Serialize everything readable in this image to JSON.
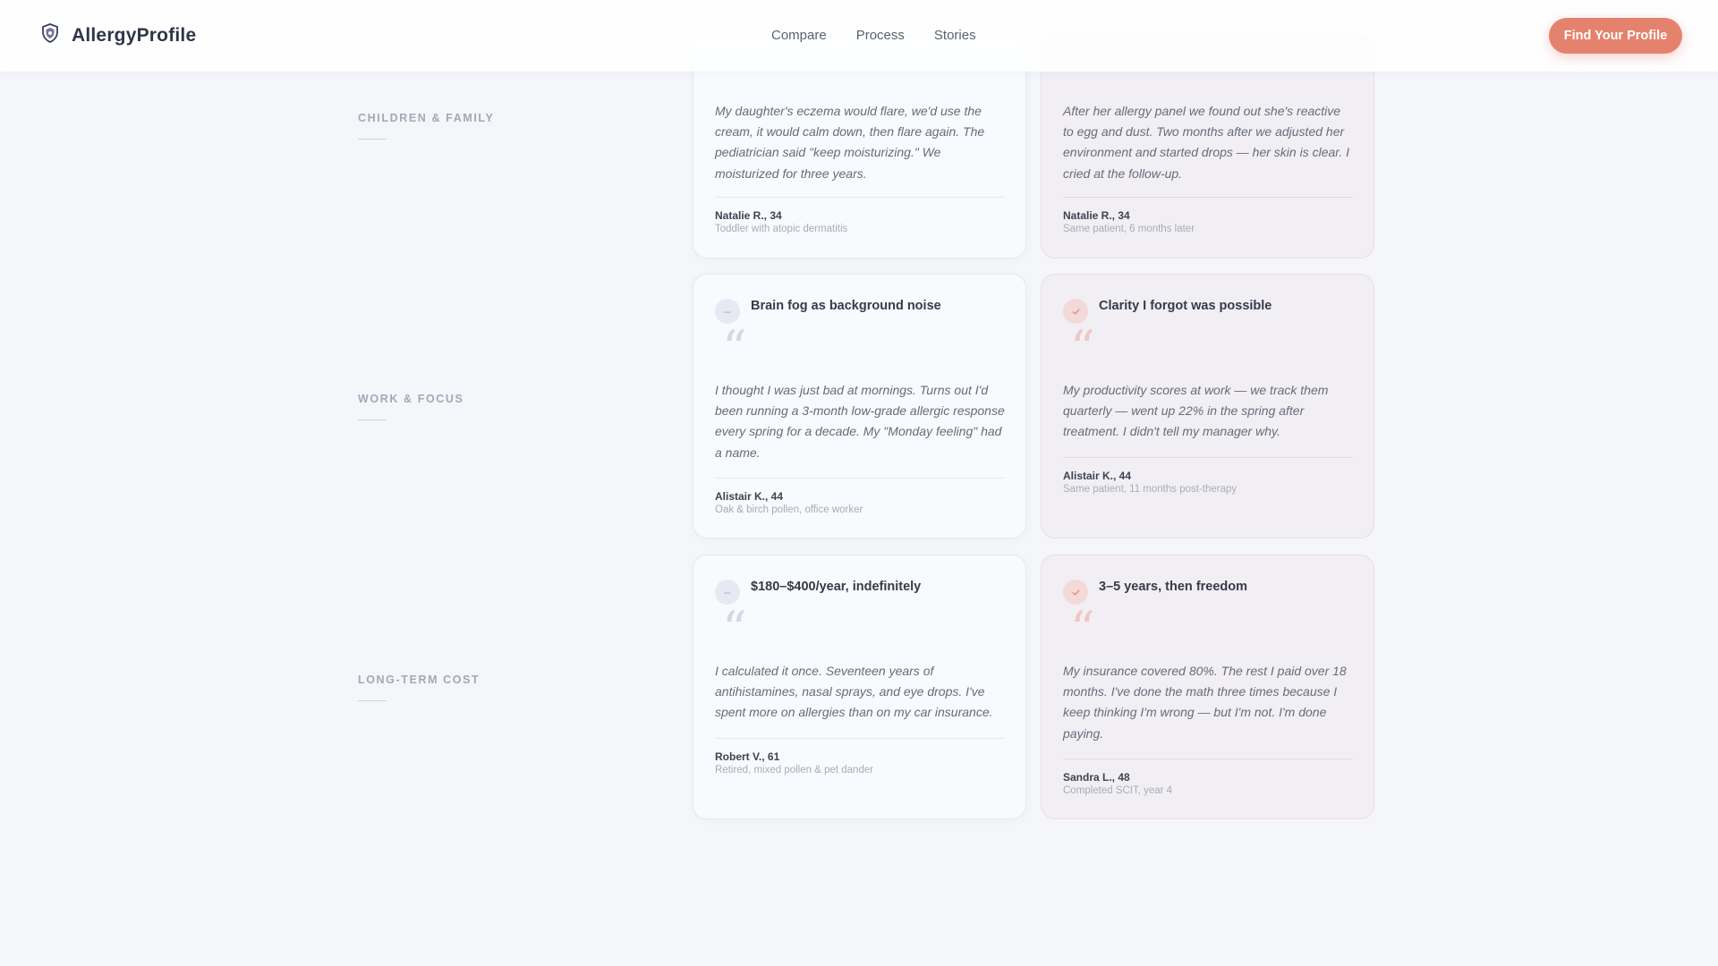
{
  "header": {
    "brand": "AllergyProfile",
    "nav": [
      "Compare",
      "Process",
      "Stories"
    ],
    "cta": "Find Your Profile"
  },
  "sections": [
    {
      "label": "CHILDREN & FAMILY",
      "before": {
        "title": "",
        "quote": "My daughter's eczema would flare, we'd use the cream, it would calm down, then flare again. The pediatrician said \"keep moisturizing.\" We moisturized for three years.",
        "author": "Natalie R., 34",
        "meta": "Toddler with atopic dermatitis"
      },
      "after": {
        "title": "",
        "quote": "After her allergy panel we found out she's reactive to egg and dust. Two months after we adjusted her environment and started drops — her skin is clear. I cried at the follow-up.",
        "author": "Natalie R., 34",
        "meta": "Same patient, 6 months later"
      }
    },
    {
      "label": "WORK & FOCUS",
      "before": {
        "title": "Brain fog as background noise",
        "quote": "I thought I was just bad at mornings. Turns out I'd been running a 3-month low-grade allergic response every spring for a decade. My \"Monday feeling\" had a name.",
        "author": "Alistair K., 44",
        "meta": "Oak & birch pollen, office worker"
      },
      "after": {
        "title": "Clarity I forgot was possible",
        "quote": "My productivity scores at work — we track them quarterly — went up 22% in the spring after treatment. I didn't tell my manager why.",
        "author": "Alistair K., 44",
        "meta": "Same patient, 11 months post-therapy"
      }
    },
    {
      "label": "LONG-TERM COST",
      "before": {
        "title": "$180–$400/year, indefinitely",
        "quote": "I calculated it once. Seventeen years of antihistamines, nasal sprays, and eye drops. I've spent more on allergies than on my car insurance.",
        "author": "Robert V., 61",
        "meta": "Retired, mixed pollen & pet dander"
      },
      "after": {
        "title": "3–5 years, then freedom",
        "quote": "My insurance covered 80%. The rest I paid over 18 months. I've done the math three times because I keep thinking I'm wrong — but I'm not. I'm done paying.",
        "author": "Sandra L., 48",
        "meta": "Completed SCIT, year 4"
      }
    }
  ],
  "icons": {
    "brand": "shield-icon",
    "before_badge": "minus-icon",
    "after_badge": "check-icon",
    "quote": "quote-icon"
  },
  "colors": {
    "accent": "#e5826e",
    "before_badge": "#e7e9f2",
    "after_badge": "#f3d9d8"
  }
}
